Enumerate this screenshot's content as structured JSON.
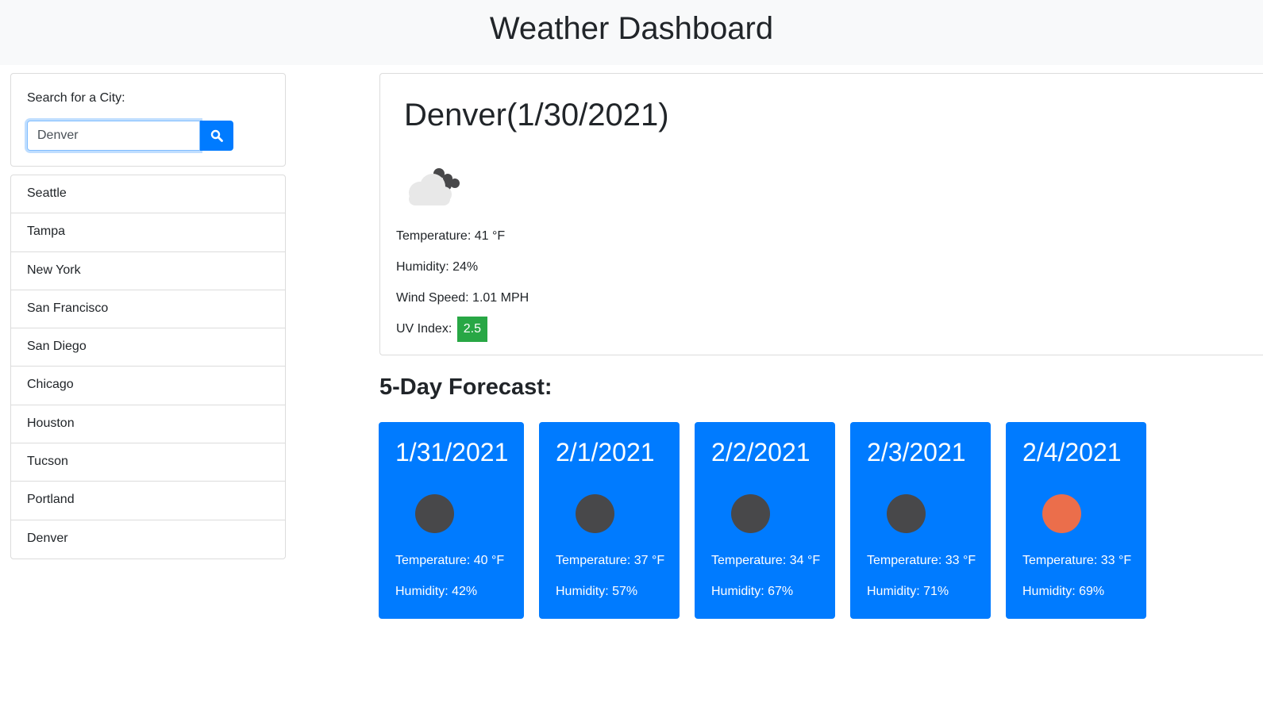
{
  "header": {
    "title": "Weather Dashboard"
  },
  "search": {
    "label": "Search for a City:",
    "value": "Denver",
    "button_icon": "search-icon"
  },
  "cities": [
    "Seattle",
    "Tampa",
    "New York",
    "San Francisco",
    "San Diego",
    "Chicago",
    "Houston",
    "Tucson",
    "Portland",
    "Denver"
  ],
  "current": {
    "title": "Denver(1/30/2021)",
    "icon": "cloud-icon",
    "temperature": "Temperature: 41 °F",
    "humidity": "Humidity: 24%",
    "wind": "Wind Speed: 1.01 MPH",
    "uv_label": "UV Index:",
    "uv_value": "2.5",
    "uv_color": "#28a745"
  },
  "forecast": {
    "heading": "5-Day Forecast:",
    "card_color": "#007bff",
    "days": [
      {
        "date": "1/31/2021",
        "icon_color": "#48484a",
        "temperature": "Temperature: 40 °F",
        "humidity": "Humidity: 42%"
      },
      {
        "date": "2/1/2021",
        "icon_color": "#48484a",
        "temperature": "Temperature: 37 °F",
        "humidity": "Humidity: 57%"
      },
      {
        "date": "2/2/2021",
        "icon_color": "#48484a",
        "temperature": "Temperature: 34 °F",
        "humidity": "Humidity: 67%"
      },
      {
        "date": "2/3/2021",
        "icon_color": "#48484a",
        "temperature": "Temperature: 33 °F",
        "humidity": "Humidity: 71%"
      },
      {
        "date": "2/4/2021",
        "icon_color": "#eb6e4b",
        "temperature": "Temperature: 33 °F",
        "humidity": "Humidity: 69%"
      }
    ]
  }
}
